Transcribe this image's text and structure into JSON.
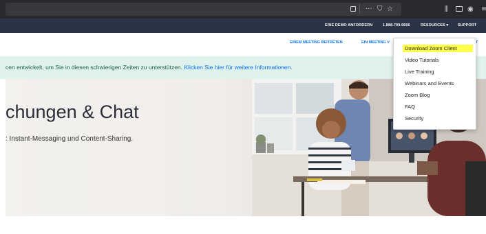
{
  "browser": {
    "icons": [
      "reader-view-icon",
      "more-actions-icon",
      "pocket-icon",
      "bookmark-star-icon",
      "library-icon",
      "sidebar-icon",
      "account-icon",
      "menu-icon"
    ]
  },
  "top_nav": {
    "demo": "EINE DEMO ANFORDERN",
    "phone": "1.888.799.9666",
    "resources": "RESOURCES",
    "support": "SUPPORT"
  },
  "secondary_nav": {
    "join": "EINEM MEETING BEITRETEN",
    "host_partial": "EIN MEETING V",
    "right_partial": "T"
  },
  "banner": {
    "text": "cen entwickelt, um Sie in diesen schwierigen Zeiten zu unterstützen. ",
    "link": "Klicken Sie hier für weitere Informationen."
  },
  "hero": {
    "title": "chungen & Chat",
    "subtitle": ": Instant-Messaging und Content-Sharing."
  },
  "resources_menu": {
    "items": [
      "Download Zoom Client",
      "Video Tutorials",
      "Live Training",
      "Webinars and Events",
      "Zoom Blog",
      "FAQ",
      "Security"
    ],
    "highlight_color": "#ffff4d"
  },
  "colors": {
    "top_nav_bg": "#2b3346",
    "link_blue": "#0e72ed",
    "banner_bg": "#dff2ec"
  }
}
